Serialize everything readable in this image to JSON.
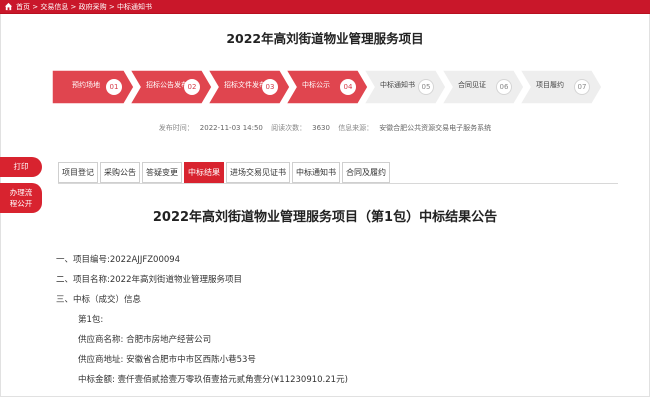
{
  "breadcrumb": {
    "text": "首页 > 交易信息 > 政府采购 > 中标通知书"
  },
  "project": {
    "title": "2022年高刘街道物业管理服务项目"
  },
  "steps": [
    {
      "label": "预约场地",
      "num": "01",
      "active": true
    },
    {
      "label": "招标公告发布",
      "num": "02",
      "active": true
    },
    {
      "label": "招标文件发布",
      "num": "03",
      "active": true
    },
    {
      "label": "中标公示",
      "num": "04",
      "active": true
    },
    {
      "label": "中标通知书",
      "num": "05",
      "active": false
    },
    {
      "label": "合同见证",
      "num": "06",
      "active": false
    },
    {
      "label": "项目履约",
      "num": "07",
      "active": false
    }
  ],
  "meta": {
    "publish_label": "发布时间：",
    "publish_time": "2022-11-03 14:50",
    "views_label": "阅读次数：",
    "views": "3630",
    "source_label": "信息来源：",
    "source": "安徽合肥公共资源交易电子服务系统"
  },
  "side": {
    "print_label": "打印",
    "flow_line1": "办理流",
    "flow_line2": "程公开"
  },
  "tabs": [
    {
      "label": "项目登记",
      "active": false
    },
    {
      "label": "采购公告",
      "active": false
    },
    {
      "label": "答疑变更",
      "active": false
    },
    {
      "label": "中标结果",
      "active": true
    },
    {
      "label": "进场交易见证书",
      "active": false
    },
    {
      "label": "中标通知书",
      "active": false
    },
    {
      "label": "合同及履约",
      "active": false
    }
  ],
  "notice": {
    "title": "2022年高刘街道物业管理服务项目（第1包）中标结果公告",
    "lines": [
      "一、项目编号:2022AJJFZ00094",
      "二、项目名称:2022年高刘街道物业管理服务项目",
      "三、中标（成交）信息",
      "第1包:",
      "供应商名称: 合肥市房地产经营公司",
      "供应商地址: 安徽省合肥市中市区西陈小巷53号",
      "中标金额: 壹仟壹佰贰拾壹万零玖佰壹拾元贰角壹分(¥11230910.21元)"
    ]
  },
  "colors": {
    "brand_red": "#c9172a",
    "step_active": "#e0454f",
    "step_inactive": "#eeeeee",
    "tab_active": "#d8232f"
  }
}
